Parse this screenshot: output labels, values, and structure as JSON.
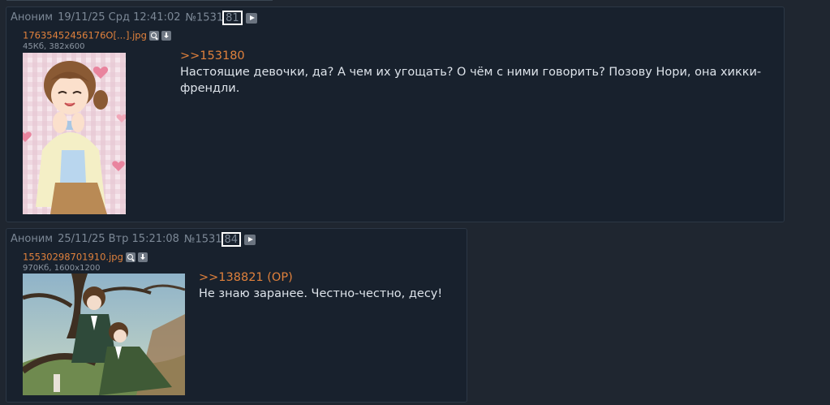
{
  "posts": [
    {
      "author": "Аноним",
      "date": "19/11/25",
      "weekday": "Срд",
      "time": "12:41:02",
      "number_prefix": "№1531",
      "number_suffix": "81",
      "file": {
        "name": "17635452456176O[...].jpg",
        "meta": "45Кб, 382x600"
      },
      "reply_link": ">>153180",
      "text": "Настоящие девочки, да? А чем их угощать? О чём с ними говорить? Позову Нори, она хикки-френдли."
    },
    {
      "author": "Аноним",
      "date": "25/11/25",
      "weekday": "Втр",
      "time": "15:21:08",
      "number_prefix": "№1531",
      "number_suffix": "84",
      "file": {
        "name": "15530298701910.jpg",
        "meta": "970Кб, 1600x1200"
      },
      "reply_link": ">>138821 (OP)",
      "text": "Не знаю заранее. Честно-честно, десу!"
    }
  ],
  "colors": {
    "page_bg": "#1f2630",
    "post_bg": "#18212d",
    "link": "#e0813c",
    "header_text": "#7c8896",
    "body_text": "#dde3ea"
  },
  "icons": [
    "play-icon",
    "search-icon",
    "download-icon"
  ]
}
